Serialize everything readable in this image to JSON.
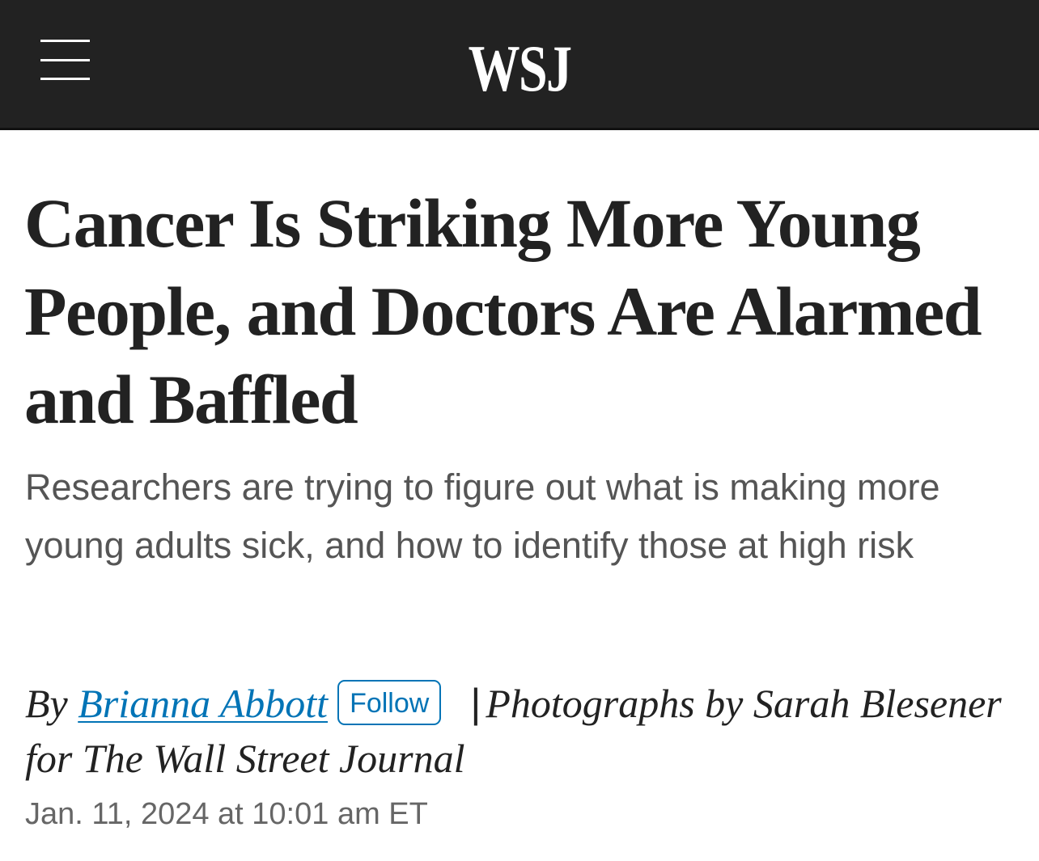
{
  "header": {
    "menu_icon": "hamburger-menu-icon",
    "logo_text": "WSJ",
    "background_color": "#222222"
  },
  "article": {
    "headline": "Cancer Is Striking More Young People, and Doctors Are Alarmed and Baffled",
    "dek": "Researchers are trying to figure out what is making more young adults sick, and how to identify those at high risk",
    "byline": {
      "prefix": "By",
      "author": "Brianna Abbott",
      "follow_label": "Follow",
      "separator": "|",
      "credit": "Photographs by Sarah Blesener for The Wall Street Journal"
    },
    "timestamp": "Jan. 11, 2024 at 10:01 am ET"
  },
  "colors": {
    "link": "#0274b6",
    "headline": "#222222",
    "dek": "#555555",
    "timestamp": "#666666"
  }
}
